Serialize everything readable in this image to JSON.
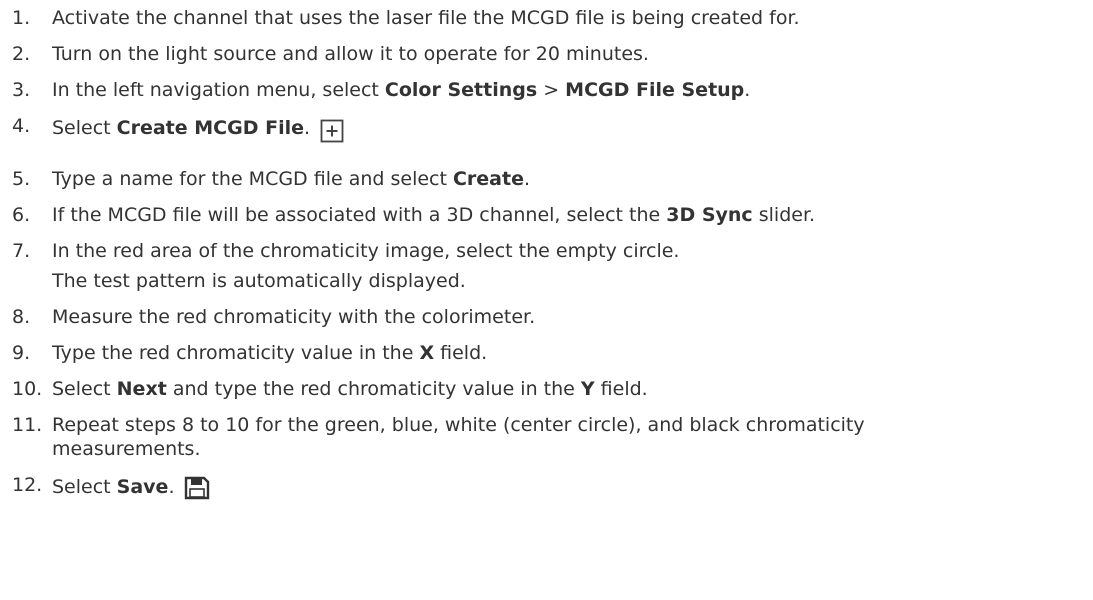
{
  "steps": [
    {
      "num": "1.",
      "parts": [
        {
          "t": "Activate the channel that uses the laser file the MCGD file is being created for."
        }
      ]
    },
    {
      "num": "2.",
      "parts": [
        {
          "t": "Turn on the light source and allow it to operate for 20 minutes."
        }
      ]
    },
    {
      "num": "3.",
      "parts": [
        {
          "t": "In the left navigation menu, select "
        },
        {
          "b": "Color Settings"
        },
        {
          "t": " > "
        },
        {
          "b": "MCGD File Setup"
        },
        {
          "t": "."
        }
      ]
    },
    {
      "num": "4.",
      "parts": [
        {
          "t": "Select "
        },
        {
          "b": "Create MCGD File"
        },
        {
          "t": "."
        }
      ],
      "icon": "plus-box-icon"
    },
    {
      "num": "5.",
      "parts": [
        {
          "t": "Type a name for the MCGD file and select "
        },
        {
          "b": "Create"
        },
        {
          "t": "."
        }
      ]
    },
    {
      "num": "6.",
      "parts": [
        {
          "t": "If the MCGD file will be associated with a 3D channel, select the "
        },
        {
          "b": "3D Sync"
        },
        {
          "t": " slider."
        }
      ]
    },
    {
      "num": "7.",
      "parts": [
        {
          "t": "In the red area of the chromaticity image, select the empty circle."
        }
      ],
      "sub": "The test pattern is automatically displayed."
    },
    {
      "num": "8.",
      "parts": [
        {
          "t": "Measure the red chromaticity with the colorimeter."
        }
      ]
    },
    {
      "num": "9.",
      "parts": [
        {
          "t": "Type the red chromaticity value in the "
        },
        {
          "b": "X"
        },
        {
          "t": " field."
        }
      ]
    },
    {
      "num": "10.",
      "parts": [
        {
          "t": "Select "
        },
        {
          "b": "Next"
        },
        {
          "t": " and type the red chromaticity value in the "
        },
        {
          "b": "Y"
        },
        {
          "t": " field."
        }
      ]
    },
    {
      "num": "11.",
      "parts": [
        {
          "t": "Repeat steps 8 to 10 for the green, blue, white (center circle), and black chromaticity"
        }
      ],
      "sub": "measurements."
    },
    {
      "num": "12.",
      "parts": [
        {
          "t": "Select "
        },
        {
          "b": "Save"
        },
        {
          "t": "."
        }
      ],
      "icon": "save-icon"
    }
  ]
}
